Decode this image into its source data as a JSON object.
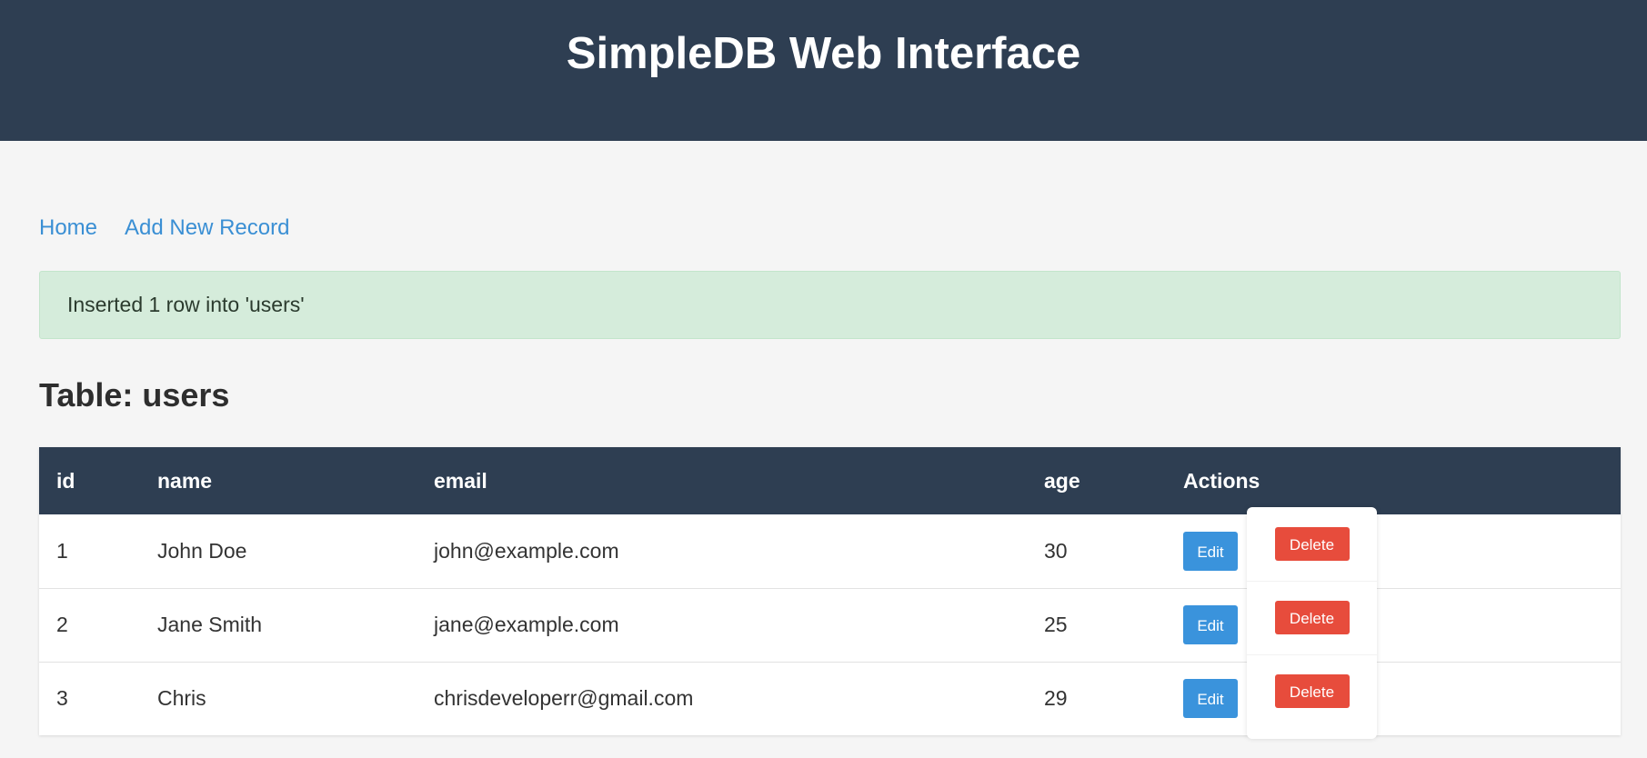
{
  "header": {
    "title": "SimpleDB Web Interface"
  },
  "nav": {
    "home": "Home",
    "add_new": "Add New Record"
  },
  "alert": {
    "message": "Inserted 1 row into 'users'"
  },
  "table": {
    "title": "Table: users",
    "columns": [
      "id",
      "name",
      "email",
      "age",
      "Actions"
    ],
    "rows": [
      {
        "id": "1",
        "name": "John Doe",
        "email": "john@example.com",
        "age": "30"
      },
      {
        "id": "2",
        "name": "Jane Smith",
        "email": "jane@example.com",
        "age": "25"
      },
      {
        "id": "3",
        "name": "Chris",
        "email": "chrisdeveloperr@gmail.com",
        "age": "29"
      }
    ],
    "edit_label": "Edit",
    "delete_label": "Delete"
  },
  "colors": {
    "header_bg": "#2e3e52",
    "link": "#3a8fd4",
    "alert_bg": "#d5ecdb",
    "edit_button": "#3a93dc",
    "delete_button": "#e74c3c"
  }
}
